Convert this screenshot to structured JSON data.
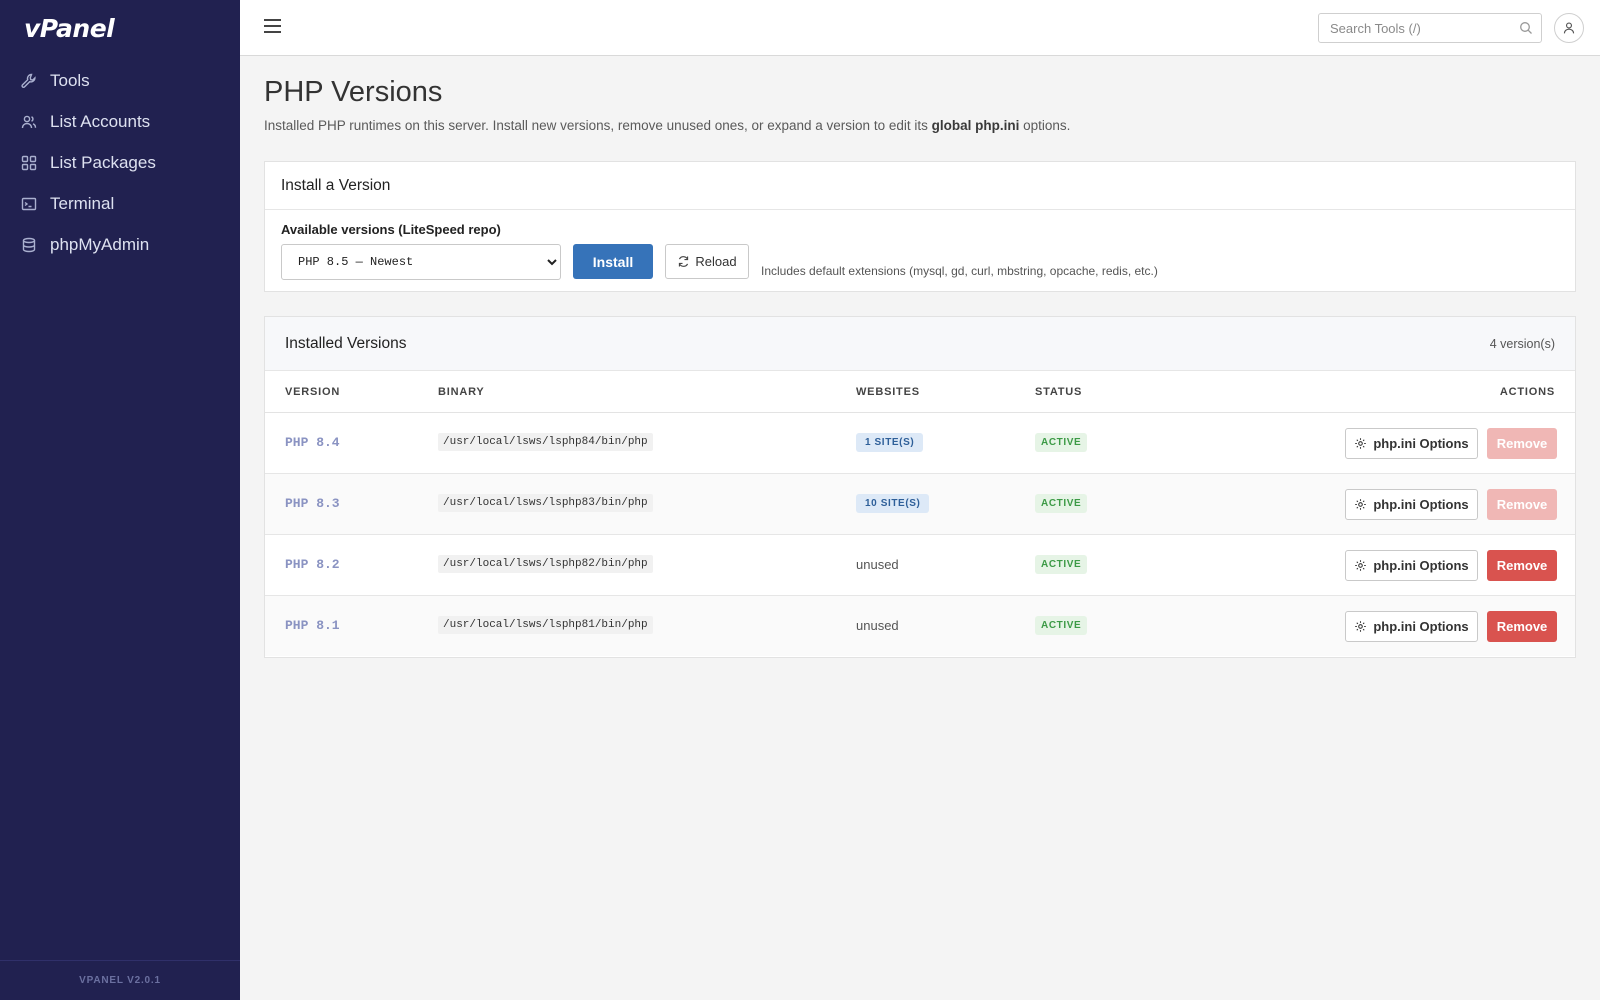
{
  "brand": {
    "logo": "vPanel",
    "version": "VPANEL V2.0.1"
  },
  "sidebar": {
    "items": [
      {
        "label": "Tools",
        "icon": "wrench-icon"
      },
      {
        "label": "List Accounts",
        "icon": "users-icon"
      },
      {
        "label": "List Packages",
        "icon": "grid-icon"
      },
      {
        "label": "Terminal",
        "icon": "terminal-icon"
      },
      {
        "label": "phpMyAdmin",
        "icon": "database-icon"
      }
    ]
  },
  "topbar": {
    "search_placeholder": "Search Tools (/)"
  },
  "page": {
    "title": "PHP Versions",
    "subtitle_pre": "Installed PHP runtimes on this server. Install new versions, remove unused ones, or expand a version to edit its ",
    "subtitle_bold": "global php.ini",
    "subtitle_post": " options."
  },
  "install": {
    "title": "Install a Version",
    "label": "Available versions (LiteSpeed repo)",
    "selected": "PHP 8.5 — Newest",
    "install_label": "Install",
    "reload_label": "Reload",
    "hint": "Includes default extensions (mysql, gd, curl, mbstring, opcache, redis, etc.)"
  },
  "installed": {
    "title": "Installed Versions",
    "count": "4 version(s)",
    "columns": [
      "VERSION",
      "BINARY",
      "WEBSITES",
      "STATUS",
      "ACTIONS"
    ],
    "rows": [
      {
        "version": "PHP 8.4",
        "binary": "/usr/local/lsws/lsphp84/bin/php",
        "websites": "1 SITE(S)",
        "status": "ACTIVE",
        "options_label": "php.ini Options",
        "remove_label": "Remove"
      },
      {
        "version": "PHP 8.3",
        "binary": "/usr/local/lsws/lsphp83/bin/php",
        "websites": "10 SITE(S)",
        "status": "ACTIVE",
        "options_label": "php.ini Options",
        "remove_label": "Remove"
      },
      {
        "version": "PHP 8.2",
        "binary": "/usr/local/lsws/lsphp82/bin/php",
        "websites": "unused",
        "status": "ACTIVE",
        "options_label": "php.ini Options",
        "remove_label": "Remove"
      },
      {
        "version": "PHP 8.1",
        "binary": "/usr/local/lsws/lsphp81/bin/php",
        "websites": "unused",
        "status": "ACTIVE",
        "options_label": "php.ini Options",
        "remove_label": "Remove"
      }
    ]
  }
}
